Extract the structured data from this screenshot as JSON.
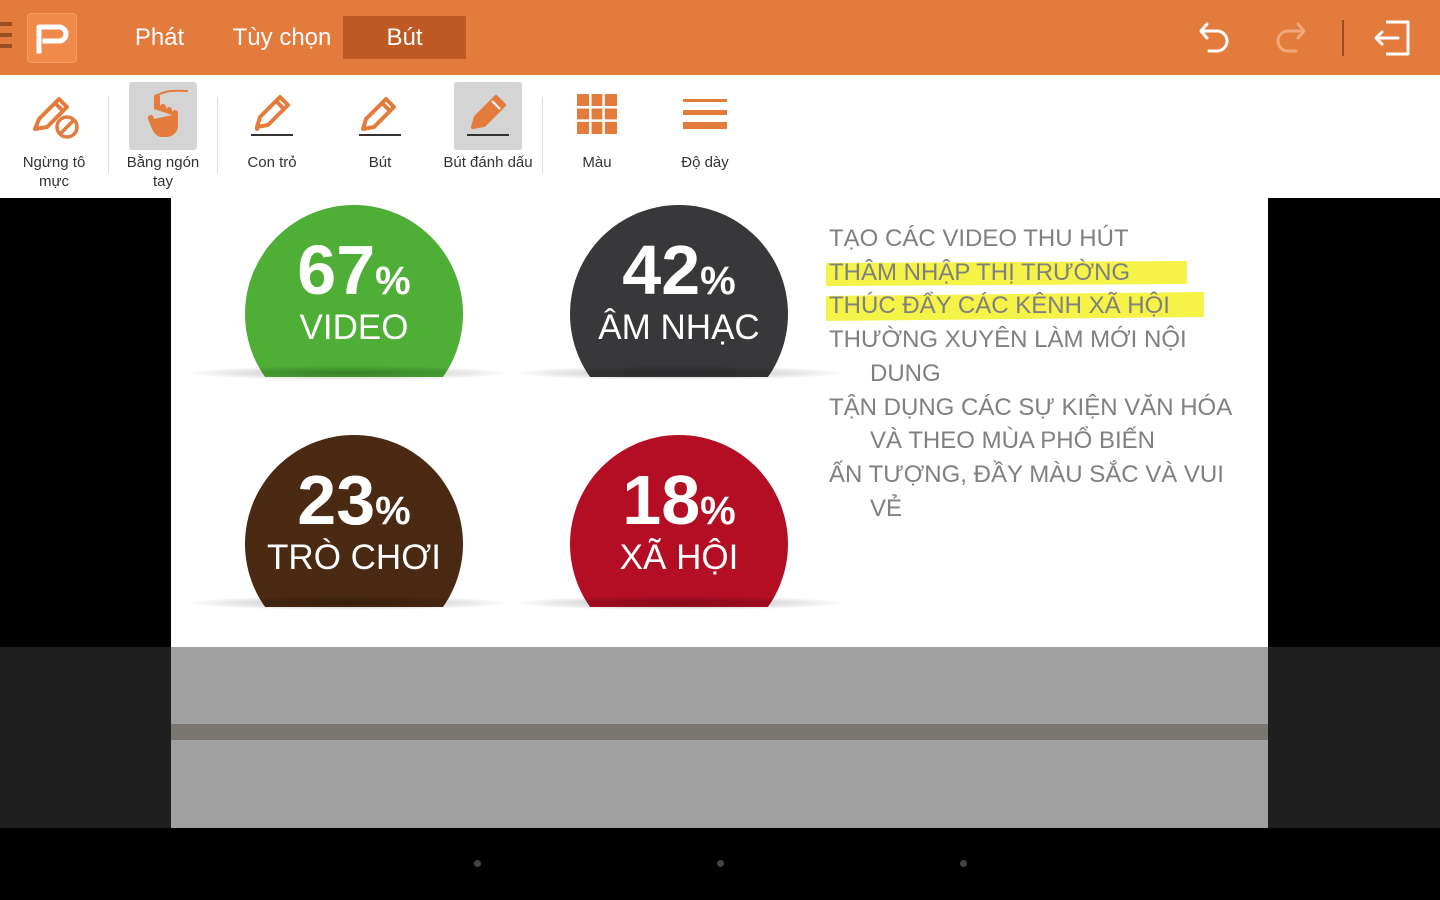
{
  "app": {
    "tabs": [
      {
        "label": "Phát",
        "active": false
      },
      {
        "label": "Tùy chọn",
        "active": false
      },
      {
        "label": "Bút",
        "active": true
      }
    ],
    "accent_color": "#E37B3D",
    "active_tab_color": "#C05A25"
  },
  "toolbar": {
    "tools": [
      {
        "label_line1": "Ngừng tô",
        "label_line2": "mực",
        "icon": "stop-ink-icon",
        "selected": false
      },
      {
        "label_line1": "Bằng ngón",
        "label_line2": "tay",
        "icon": "finger-draw-icon",
        "selected": true
      },
      {
        "label_line1": "Con trỏ",
        "label_line2": "",
        "icon": "pointer-pen-icon",
        "selected": false
      },
      {
        "label_line1": "Bút",
        "label_line2": "",
        "icon": "pen-icon",
        "selected": false
      },
      {
        "label_line1": "Bút đánh dấu",
        "label_line2": "",
        "icon": "highlighter-icon",
        "selected": true
      },
      {
        "label_line1": "Màu",
        "label_line2": "",
        "icon": "color-grid-icon",
        "selected": false
      },
      {
        "label_line1": "Độ dày",
        "label_line2": "",
        "icon": "thickness-icon",
        "selected": false
      }
    ]
  },
  "slide": {
    "stats": [
      {
        "value": "67",
        "unit": "%",
        "caption": "VIDEO",
        "color": "#4EAE35"
      },
      {
        "value": "42",
        "unit": "%",
        "caption": "ÂM NHẠC",
        "color": "#38383A"
      },
      {
        "value": "23",
        "unit": "%",
        "caption": "TRÒ CHƠI",
        "color": "#4A2A12"
      },
      {
        "value": "18",
        "unit": "%",
        "caption": "XÃ HỘI",
        "color": "#B30E24"
      }
    ],
    "bullets": [
      {
        "line1": "TẠO CÁC VIDEO THU HÚT",
        "line2": ""
      },
      {
        "line1": "THÂM NHẬP THỊ TRƯỜNG",
        "line2": ""
      },
      {
        "line1": "THÚC ĐẨY CÁC KÊNH XÃ HỘI",
        "line2": ""
      },
      {
        "line1": "THƯỜNG XUYÊN LÀM MỚI NỘI",
        "line2": "DUNG"
      },
      {
        "line1": "TẬN DỤNG CÁC SỰ KIỆN VĂN HÓA",
        "line2": "VÀ THEO MÙA PHỔ BIẾN"
      },
      {
        "line1": "ẤN TƯỢNG, ĐẦY MÀU SẮC VÀ VUI",
        "line2": "VẺ"
      }
    ],
    "highlight_color": "#F4F233"
  }
}
